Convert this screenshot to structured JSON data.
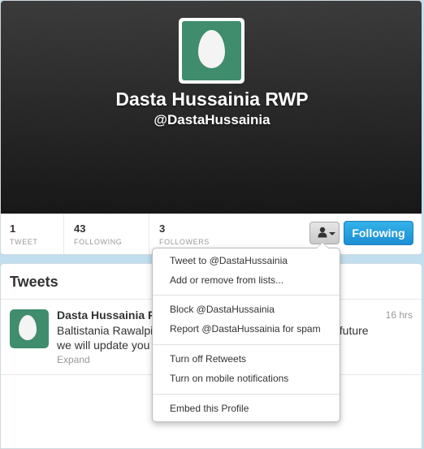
{
  "profile": {
    "fullname": "Dasta Hussainia RWP",
    "screenname": "@DastaHussainia",
    "colors": {
      "header_bg": "#262626",
      "avatar_bg": "#3f8d6c",
      "accent": "#1d8ed4"
    }
  },
  "stats": [
    {
      "count": "1",
      "label": "TWEET"
    },
    {
      "count": "43",
      "label": "FOLLOWING"
    },
    {
      "count": "3",
      "label": "FOLLOWERS"
    }
  ],
  "actions": {
    "user_menu_icon": "person-icon",
    "following_label": "Following"
  },
  "dropdown": {
    "items": [
      "Tweet to @DastaHussainia",
      "Add or remove from lists...",
      "Block @DastaHussainia",
      "Report @DastaHussainia for spam",
      "Turn off Retweets",
      "Turn on mobile notifications",
      "Embed this Profile"
    ]
  },
  "tweets": {
    "heading": "Tweets",
    "items": [
      {
        "author": "Dasta Hussainia R",
        "time": "16 hrs",
        "text_line1": "Baltistania Rawalpi                                                  ah In future",
        "text_line2": "we will update you                                                  ts",
        "expand": "Expand"
      }
    ]
  }
}
